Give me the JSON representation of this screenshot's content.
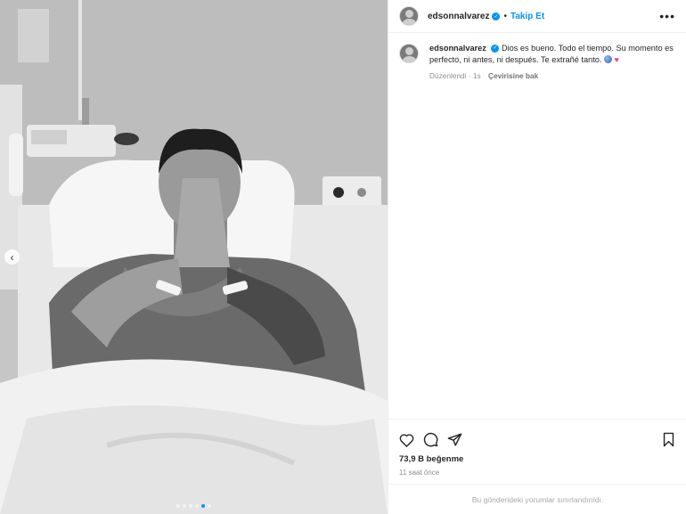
{
  "post": {
    "carousel_dots": 6,
    "active_dot": 5
  },
  "header": {
    "username": "edsonnalvarez",
    "separator": "•",
    "follow_label": "Takip Et",
    "more_label": "•••"
  },
  "caption": {
    "username": "edsonnalvarez",
    "text": "Dios es bueno. Todo el tiempo. Su momento es perfecto, ni antes, ni después. Te extrañé tanto.",
    "edited_label": "Düzenlendi · 1s",
    "translate_label": "Çevirisine bak"
  },
  "actions": {
    "like_icon": "heart-icon",
    "comment_icon": "comment-icon",
    "share_icon": "share-icon",
    "save_icon": "bookmark-icon"
  },
  "stats": {
    "likes": "73,9 B beğenme",
    "time_ago": "11 saat önce"
  },
  "footer": {
    "comments_limited": "Bu gönderideki yorumlar sınırlandırıldı."
  },
  "colors": {
    "accent": "#0095f6",
    "text": "#262626",
    "muted": "#8e8e8e",
    "border": "#efefef"
  }
}
